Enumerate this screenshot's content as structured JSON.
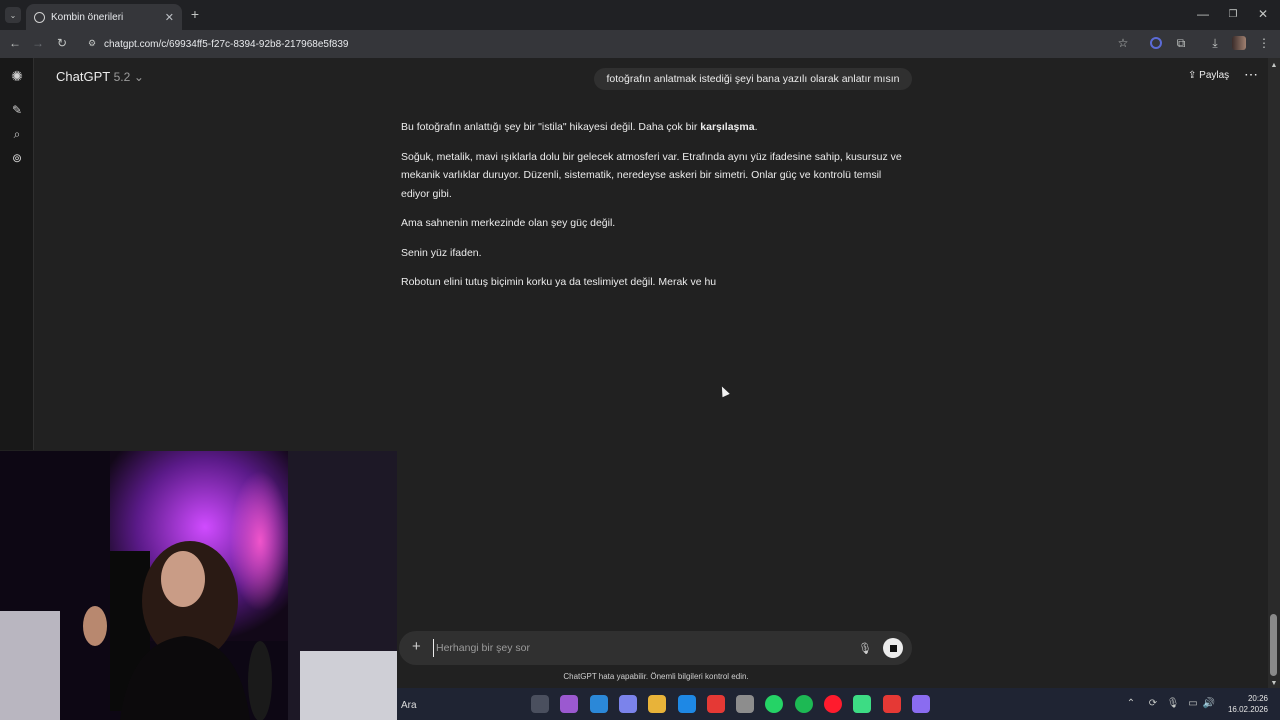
{
  "browser": {
    "tab_title": "Kombin önerileri",
    "new_tab_label": "+",
    "url": "chatgpt.com/c/69934ff5-f27c-8394-92b8-217968e5f839"
  },
  "app": {
    "model_name": "ChatGPT",
    "model_version": "5.2",
    "chat_title_pill": "fotoğrafın anlatmak istediği şeyi  bana yazılı olarak anlatır mısın",
    "share_label": "Paylaş"
  },
  "messages": {
    "p1_pre": "Bu fotoğrafın anlattığı şey bir \"istila\" hikayesi değil. Daha çok bir ",
    "p1_bold": "karşılaşma",
    "p1_post": ".",
    "p2": "Soğuk, metalik, mavi ışıklarla dolu bir gelecek atmosferi var. Etrafında aynı yüz ifadesine sahip, kusursuz ve mekanik varlıklar duruyor. Düzenli, sistematik, neredeyse askeri bir simetri. Onlar güç ve kontrolü temsil ediyor gibi.",
    "p3": "Ama sahnenin merkezinde olan şey güç değil.",
    "p4": "Senin yüz ifaden.",
    "p5": "Robotun elini tutuş biçimin korku ya da teslimiyet değil. Merak ve hu"
  },
  "composer": {
    "placeholder": "Herhangi bir şey sor",
    "disclaimer": "ChatGPT hata yapabilir. Önemli bilgileri kontrol edin."
  },
  "taskbar": {
    "search_label": "Ara",
    "time": "20:26",
    "date": "16.02.2026",
    "app_colors": [
      "#4a4f5e",
      "#9b59d0",
      "#2b88d8",
      "#7b83eb",
      "#e8b339",
      "#1e88e5",
      "#e53935",
      "#8d8d8d",
      "#25d366",
      "#1db954",
      "#ff1b2d",
      "#3ddc84",
      "#e53935",
      "#8a6cf0"
    ]
  }
}
